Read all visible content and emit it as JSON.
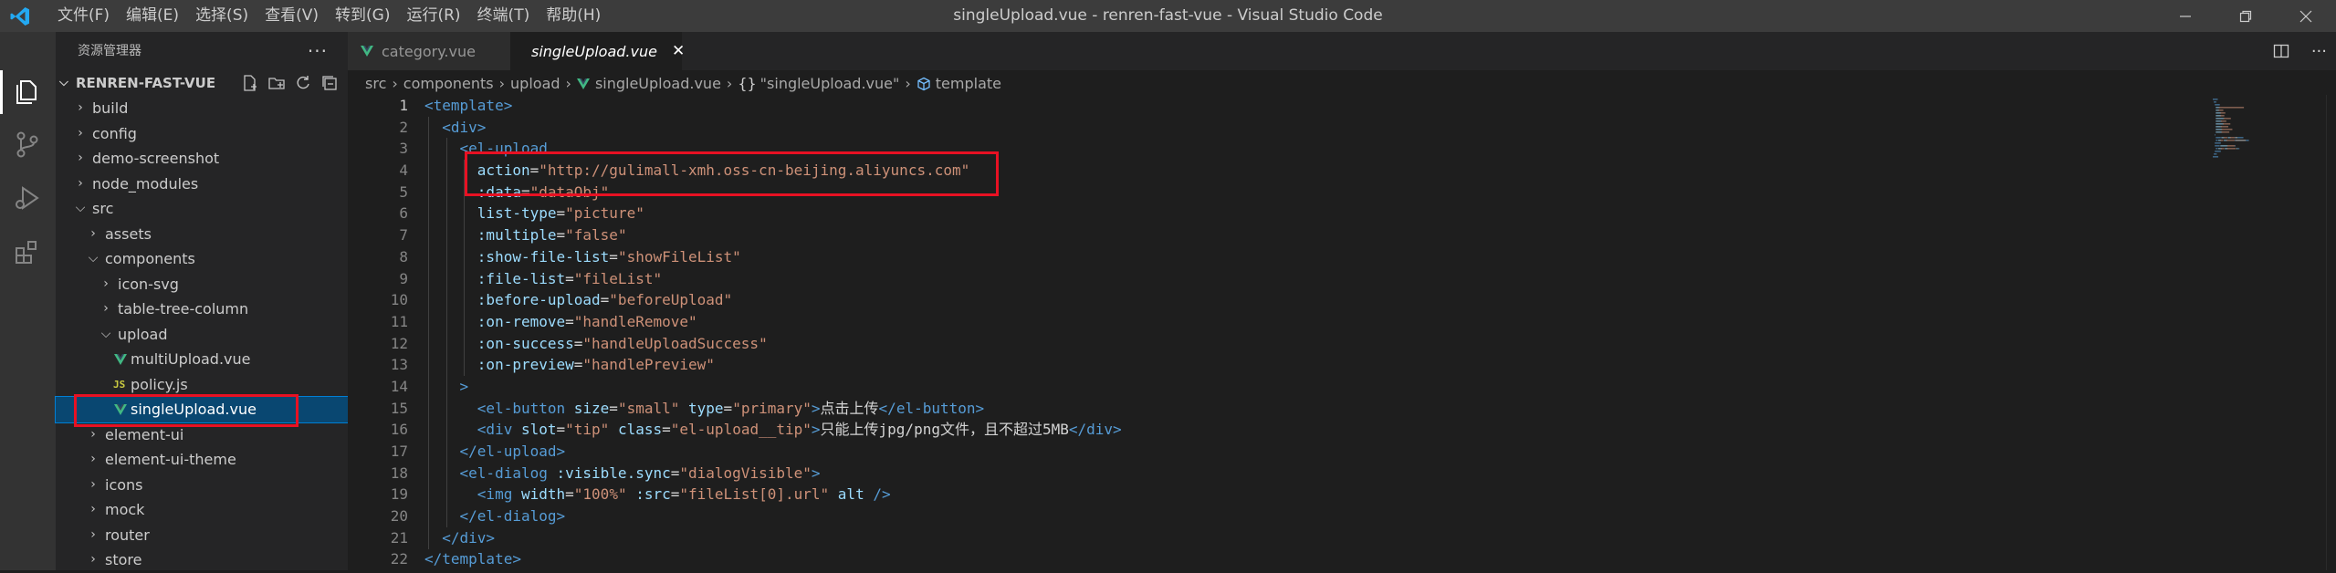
{
  "window": {
    "title": "singleUpload.vue - renren-fast-vue - Visual Studio Code",
    "menu": [
      "文件(F)",
      "编辑(E)",
      "选择(S)",
      "查看(V)",
      "转到(G)",
      "运行(R)",
      "终端(T)",
      "帮助(H)"
    ]
  },
  "sidebar": {
    "header": "资源管理器",
    "project": "RENREN-FAST-VUE",
    "items": [
      {
        "label": "build",
        "depth": 0,
        "kind": "folder",
        "expanded": false
      },
      {
        "label": "config",
        "depth": 0,
        "kind": "folder",
        "expanded": false
      },
      {
        "label": "demo-screenshot",
        "depth": 0,
        "kind": "folder",
        "expanded": false
      },
      {
        "label": "node_modules",
        "depth": 0,
        "kind": "folder",
        "expanded": false
      },
      {
        "label": "src",
        "depth": 0,
        "kind": "folder",
        "expanded": true
      },
      {
        "label": "assets",
        "depth": 1,
        "kind": "folder",
        "expanded": false
      },
      {
        "label": "components",
        "depth": 1,
        "kind": "folder",
        "expanded": true
      },
      {
        "label": "icon-svg",
        "depth": 2,
        "kind": "folder",
        "expanded": false
      },
      {
        "label": "table-tree-column",
        "depth": 2,
        "kind": "folder",
        "expanded": false
      },
      {
        "label": "upload",
        "depth": 2,
        "kind": "folder",
        "expanded": true
      },
      {
        "label": "multiUpload.vue",
        "depth": 3,
        "kind": "vue"
      },
      {
        "label": "policy.js",
        "depth": 3,
        "kind": "js"
      },
      {
        "label": "singleUpload.vue",
        "depth": 3,
        "kind": "vue",
        "selected": true
      },
      {
        "label": "element-ui",
        "depth": 1,
        "kind": "folder",
        "expanded": false
      },
      {
        "label": "element-ui-theme",
        "depth": 1,
        "kind": "folder",
        "expanded": false
      },
      {
        "label": "icons",
        "depth": 1,
        "kind": "folder",
        "expanded": false
      },
      {
        "label": "mock",
        "depth": 1,
        "kind": "folder",
        "expanded": false
      },
      {
        "label": "router",
        "depth": 1,
        "kind": "folder",
        "expanded": false
      },
      {
        "label": "store",
        "depth": 1,
        "kind": "folder",
        "expanded": false
      }
    ]
  },
  "tabs": [
    {
      "label": "category.vue",
      "active": false
    },
    {
      "label": "singleUpload.vue",
      "active": true
    }
  ],
  "breadcrumb": [
    "src",
    "components",
    "upload",
    "singleUpload.vue",
    "\"singleUpload.vue\"",
    "template"
  ],
  "editor": {
    "line_numbers": [
      "1",
      "2",
      "3",
      "4",
      "5",
      "6",
      "7",
      "8",
      "9",
      "10",
      "11",
      "12",
      "13",
      "14",
      "15",
      "16",
      "17",
      "18",
      "19",
      "20",
      "21",
      "22"
    ],
    "current_line": 1,
    "lines": [
      [
        {
          "t": "tag",
          "v": "<template>"
        }
      ],
      [
        {
          "t": "text",
          "v": "  "
        },
        {
          "t": "tag",
          "v": "<div>"
        }
      ],
      [
        {
          "t": "text",
          "v": "    "
        },
        {
          "t": "tag",
          "v": "<el-upload"
        }
      ],
      [
        {
          "t": "text",
          "v": "      "
        },
        {
          "t": "attr",
          "v": "action"
        },
        {
          "t": "eq",
          "v": "="
        },
        {
          "t": "str",
          "v": "\"http://gulimall-xmh.oss-cn-beijing.aliyuncs.com\""
        }
      ],
      [
        {
          "t": "text",
          "v": "      "
        },
        {
          "t": "attr",
          "v": ":data"
        },
        {
          "t": "eq",
          "v": "="
        },
        {
          "t": "str",
          "v": "\"dataObj\""
        }
      ],
      [
        {
          "t": "text",
          "v": "      "
        },
        {
          "t": "attr",
          "v": "list-type"
        },
        {
          "t": "eq",
          "v": "="
        },
        {
          "t": "str",
          "v": "\"picture\""
        }
      ],
      [
        {
          "t": "text",
          "v": "      "
        },
        {
          "t": "attr",
          "v": ":multiple"
        },
        {
          "t": "eq",
          "v": "="
        },
        {
          "t": "str",
          "v": "\"false\""
        }
      ],
      [
        {
          "t": "text",
          "v": "      "
        },
        {
          "t": "attr",
          "v": ":show-file-list"
        },
        {
          "t": "eq",
          "v": "="
        },
        {
          "t": "str",
          "v": "\"showFileList\""
        }
      ],
      [
        {
          "t": "text",
          "v": "      "
        },
        {
          "t": "attr",
          "v": ":file-list"
        },
        {
          "t": "eq",
          "v": "="
        },
        {
          "t": "str",
          "v": "\"fileList\""
        }
      ],
      [
        {
          "t": "text",
          "v": "      "
        },
        {
          "t": "attr",
          "v": ":before-upload"
        },
        {
          "t": "eq",
          "v": "="
        },
        {
          "t": "str",
          "v": "\"beforeUpload\""
        }
      ],
      [
        {
          "t": "text",
          "v": "      "
        },
        {
          "t": "attr",
          "v": ":on-remove"
        },
        {
          "t": "eq",
          "v": "="
        },
        {
          "t": "str",
          "v": "\"handleRemove\""
        }
      ],
      [
        {
          "t": "text",
          "v": "      "
        },
        {
          "t": "attr",
          "v": ":on-success"
        },
        {
          "t": "eq",
          "v": "="
        },
        {
          "t": "str",
          "v": "\"handleUploadSuccess\""
        }
      ],
      [
        {
          "t": "text",
          "v": "      "
        },
        {
          "t": "attr",
          "v": ":on-preview"
        },
        {
          "t": "eq",
          "v": "="
        },
        {
          "t": "str",
          "v": "\"handlePreview\""
        }
      ],
      [
        {
          "t": "text",
          "v": "    "
        },
        {
          "t": "tag",
          "v": ">"
        }
      ],
      [
        {
          "t": "text",
          "v": "      "
        },
        {
          "t": "tag",
          "v": "<el-button"
        },
        {
          "t": "text",
          "v": " "
        },
        {
          "t": "attr",
          "v": "size"
        },
        {
          "t": "eq",
          "v": "="
        },
        {
          "t": "str",
          "v": "\"small\""
        },
        {
          "t": "text",
          "v": " "
        },
        {
          "t": "attr",
          "v": "type"
        },
        {
          "t": "eq",
          "v": "="
        },
        {
          "t": "str",
          "v": "\"primary\""
        },
        {
          "t": "tag",
          "v": ">"
        },
        {
          "t": "text",
          "v": "点击上传"
        },
        {
          "t": "tag",
          "v": "</el-button>"
        }
      ],
      [
        {
          "t": "text",
          "v": "      "
        },
        {
          "t": "tag",
          "v": "<div"
        },
        {
          "t": "text",
          "v": " "
        },
        {
          "t": "attr",
          "v": "slot"
        },
        {
          "t": "eq",
          "v": "="
        },
        {
          "t": "str",
          "v": "\"tip\""
        },
        {
          "t": "text",
          "v": " "
        },
        {
          "t": "attr",
          "v": "class"
        },
        {
          "t": "eq",
          "v": "="
        },
        {
          "t": "str",
          "v": "\"el-upload__tip\""
        },
        {
          "t": "tag",
          "v": ">"
        },
        {
          "t": "text",
          "v": "只能上传jpg/png文件，且不超过5MB"
        },
        {
          "t": "tag",
          "v": "</div>"
        }
      ],
      [
        {
          "t": "text",
          "v": "    "
        },
        {
          "t": "tag",
          "v": "</el-upload>"
        }
      ],
      [
        {
          "t": "text",
          "v": "    "
        },
        {
          "t": "tag",
          "v": "<el-dialog"
        },
        {
          "t": "text",
          "v": " "
        },
        {
          "t": "attr",
          "v": ":visible.sync"
        },
        {
          "t": "eq",
          "v": "="
        },
        {
          "t": "str",
          "v": "\"dialogVisible\""
        },
        {
          "t": "tag",
          "v": ">"
        }
      ],
      [
        {
          "t": "text",
          "v": "      "
        },
        {
          "t": "tag",
          "v": "<img"
        },
        {
          "t": "text",
          "v": " "
        },
        {
          "t": "attr",
          "v": "width"
        },
        {
          "t": "eq",
          "v": "="
        },
        {
          "t": "str",
          "v": "\"100%\""
        },
        {
          "t": "text",
          "v": " "
        },
        {
          "t": "attr",
          "v": ":src"
        },
        {
          "t": "eq",
          "v": "="
        },
        {
          "t": "str",
          "v": "\"fileList[0].url\""
        },
        {
          "t": "text",
          "v": " "
        },
        {
          "t": "attr",
          "v": "alt"
        },
        {
          "t": "text",
          "v": " "
        },
        {
          "t": "tag",
          "v": "/>"
        }
      ],
      [
        {
          "t": "text",
          "v": "    "
        },
        {
          "t": "tag",
          "v": "</el-dialog>"
        }
      ],
      [
        {
          "t": "text",
          "v": "  "
        },
        {
          "t": "tag",
          "v": "</div>"
        }
      ],
      [
        {
          "t": "tag",
          "v": "</template>"
        }
      ]
    ]
  },
  "colors": {
    "accent": "#007acc",
    "highlight": "#e81123",
    "selection": "#094771",
    "vue_icon": "#41b883"
  },
  "icons": {
    "activity": [
      "files-icon",
      "source-control-icon",
      "run-debug-icon",
      "extensions-icon"
    ],
    "sidebar_tools": [
      "new-file-icon",
      "new-folder-icon",
      "refresh-icon",
      "collapse-all-icon"
    ]
  }
}
